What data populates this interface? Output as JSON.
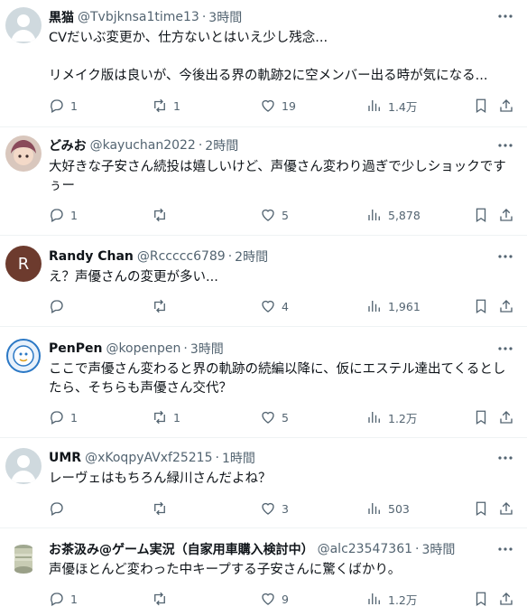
{
  "tweets": [
    {
      "name": "黒猫",
      "handle": "@Tvbjknsa1time13",
      "time": "3時間",
      "text": "CVだいぶ変更か、仕方ないとはいえ少し残念...\n\nリメイク版は良いが、今後出る界の軌跡2に空メンバー出る時が気になる...",
      "replies": "1",
      "reposts": "1",
      "likes": "19",
      "views": "1.4万",
      "avatar": "default-avatar"
    },
    {
      "name": "どみお",
      "handle": "@kayuchan2022",
      "time": "2時間",
      "text": "大好きな子安さん続投は嬉しいけど、声優さん変わり過ぎで少しショックですぅー",
      "replies": "1",
      "reposts": "",
      "likes": "5",
      "views": "5,878",
      "avatar": "photo-avatar"
    },
    {
      "name": "Randy Chan",
      "handle": "@Rccccc6789",
      "time": "2時間",
      "text": "え？声優さんの変更が多い...",
      "replies": "",
      "reposts": "",
      "likes": "4",
      "views": "1,961",
      "avatar": "letter-avatar",
      "avatar_letter": "R"
    },
    {
      "name": "PenPen",
      "handle": "@kopenpen",
      "time": "3時間",
      "text": "ここで声優さん変わると界の軌跡の続編以降に、仮にエステル達出てくるとしたら、そちらも声優さん交代？",
      "replies": "1",
      "reposts": "1",
      "likes": "5",
      "views": "1.2万",
      "avatar": "badge-avatar"
    },
    {
      "name": "UMR",
      "handle": "@xKoqpyAVxf25215",
      "time": "1時間",
      "text": "レーヴェはもちろん緑川さんだよね？",
      "replies": "",
      "reposts": "",
      "likes": "3",
      "views": "503",
      "avatar": "default-avatar"
    },
    {
      "name": "お茶汲み@ゲーム実況（自家用車購入検討中）",
      "handle": "@alc23547361",
      "time": "3時間",
      "text": "声優ほとんど変わった中キープする子安さんに驚くばかり。",
      "replies": "1",
      "reposts": "",
      "likes": "9",
      "views": "1.2万",
      "avatar": "can-avatar"
    }
  ],
  "colors": {
    "text": "#0f1419",
    "muted": "#536471",
    "divider": "#eff3f4",
    "letter_avatar_bg": "#6d3b2e"
  }
}
